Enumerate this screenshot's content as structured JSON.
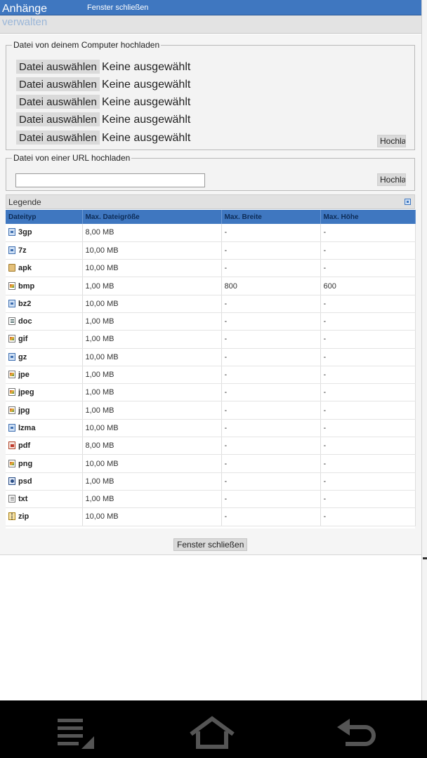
{
  "header": {
    "title_line1": "Anhänge",
    "title_line2": "verwalten",
    "close_link": "Fenster schließen"
  },
  "upload_computer": {
    "legend": "Datei von deinem Computer hochladen",
    "rows": [
      {
        "button": "Datei auswählen",
        "status": "Keine ausgewählt"
      },
      {
        "button": "Datei auswählen",
        "status": "Keine ausgewählt"
      },
      {
        "button": "Datei auswählen",
        "status": "Keine ausgewählt"
      },
      {
        "button": "Datei auswählen",
        "status": "Keine ausgewählt"
      },
      {
        "button": "Datei auswählen",
        "status": "Keine ausgewählt"
      }
    ],
    "upload_button": "Hochladen"
  },
  "upload_url": {
    "legend": "Datei von einer URL hochladen",
    "input_value": "",
    "upload_button": "Hochladen"
  },
  "legend_section": {
    "title": "Legende",
    "columns": [
      "Dateityp",
      "Max. Dateigröße",
      "Max. Breite",
      "Max. Höhe"
    ],
    "rows": [
      {
        "icon": "archive-icon",
        "type": "3gp",
        "size": "8,00 MB",
        "width": "-",
        "height": "-"
      },
      {
        "icon": "archive-icon",
        "type": "7z",
        "size": "10,00 MB",
        "width": "-",
        "height": "-"
      },
      {
        "icon": "lock-icon",
        "type": "apk",
        "size": "10,00 MB",
        "width": "-",
        "height": "-"
      },
      {
        "icon": "image-icon",
        "type": "bmp",
        "size": "1,00 MB",
        "width": "800",
        "height": "600"
      },
      {
        "icon": "archive-icon",
        "type": "bz2",
        "size": "10,00 MB",
        "width": "-",
        "height": "-"
      },
      {
        "icon": "document-icon",
        "type": "doc",
        "size": "1,00 MB",
        "width": "-",
        "height": "-"
      },
      {
        "icon": "image-icon",
        "type": "gif",
        "size": "1,00 MB",
        "width": "-",
        "height": "-"
      },
      {
        "icon": "archive-icon",
        "type": "gz",
        "size": "10,00 MB",
        "width": "-",
        "height": "-"
      },
      {
        "icon": "image-icon",
        "type": "jpe",
        "size": "1,00 MB",
        "width": "-",
        "height": "-"
      },
      {
        "icon": "image-icon",
        "type": "jpeg",
        "size": "1,00 MB",
        "width": "-",
        "height": "-"
      },
      {
        "icon": "image-icon",
        "type": "jpg",
        "size": "1,00 MB",
        "width": "-",
        "height": "-"
      },
      {
        "icon": "archive-icon",
        "type": "lzma",
        "size": "10,00 MB",
        "width": "-",
        "height": "-"
      },
      {
        "icon": "pdf-icon",
        "type": "pdf",
        "size": "8,00 MB",
        "width": "-",
        "height": "-"
      },
      {
        "icon": "image-icon",
        "type": "png",
        "size": "10,00 MB",
        "width": "-",
        "height": "-"
      },
      {
        "icon": "psd-icon",
        "type": "psd",
        "size": "1,00 MB",
        "width": "-",
        "height": "-"
      },
      {
        "icon": "text-file-icon",
        "type": "txt",
        "size": "1,00 MB",
        "width": "-",
        "height": "-"
      },
      {
        "icon": "zip-icon",
        "type": "zip",
        "size": "10,00 MB",
        "width": "-",
        "height": "-"
      }
    ]
  },
  "footer": {
    "close_button": "Fenster schließen"
  },
  "navbar": {
    "buttons": [
      "menu-icon",
      "home-icon",
      "back-icon"
    ]
  },
  "colors": {
    "accent": "#3f77c0",
    "header_text": "#0d2c57",
    "button_bg": "#dadada"
  }
}
